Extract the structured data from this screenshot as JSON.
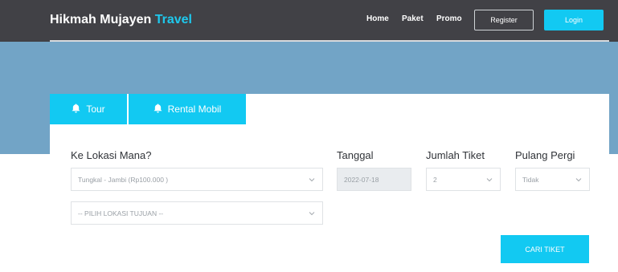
{
  "brand": {
    "name": "Hikmah Mujayen",
    "accent": "Travel"
  },
  "nav": {
    "home": "Home",
    "paket": "Paket",
    "promo": "Promo",
    "register": "Register",
    "login": "Login"
  },
  "tabs": {
    "tour": "Tour",
    "rental": "Rental Mobil"
  },
  "form": {
    "lokasi_label": "Ke Lokasi Mana?",
    "tanggal_label": "Tanggal",
    "jumlah_label": "Jumlah Tiket",
    "pulang_label": "Pulang Pergi",
    "asal_value": "Tungkal - Jambi (Rp100.000 )",
    "tujuan_value": "-- PILIH LOKASI TUJUAN --",
    "tanggal_value": "2022-07-18",
    "jumlah_value": "2",
    "pulang_value": "Tidak",
    "cari_label": "CARI TIKET"
  },
  "colors": {
    "navbar": "#414146",
    "hero": "#72a4c6",
    "accent": "#12c9f2"
  },
  "icons": {
    "tab_icon": "bell-icon",
    "select_icon": "chevron-down-icon"
  }
}
